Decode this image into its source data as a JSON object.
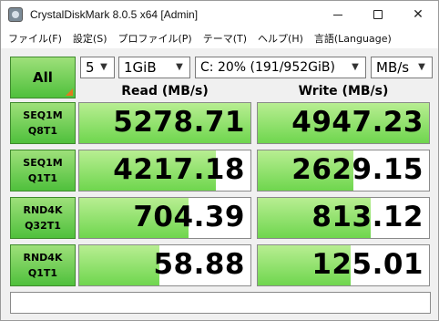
{
  "window": {
    "title": "CrystalDiskMark 8.0.5 x64 [Admin]"
  },
  "window_controls": {
    "minimize": "—",
    "maximize": "☐",
    "close": "✕"
  },
  "menu": [
    "ファイル(F)",
    "設定(S)",
    "プロファイル(P)",
    "テーマ(T)",
    "ヘルプ(H)",
    "言語(Language)"
  ],
  "toolbar": {
    "all_label": "All",
    "count": "5",
    "size": "1GiB",
    "drive": "C: 20% (191/952GiB)",
    "unit": "MB/s"
  },
  "headers": {
    "read": "Read (MB/s)",
    "write": "Write (MB/s)"
  },
  "tests": [
    {
      "line1": "SEQ1M",
      "line2": "Q8T1",
      "read": "5278.71",
      "write": "4947.23",
      "read_fill": 1.0,
      "write_fill": 1.0
    },
    {
      "line1": "SEQ1M",
      "line2": "Q1T1",
      "read": "4217.18",
      "write": "2629.15",
      "read_fill": 0.8,
      "write_fill": 0.56
    },
    {
      "line1": "RND4K",
      "line2": "Q32T1",
      "read": "704.39",
      "write": "813.12",
      "read_fill": 0.64,
      "write_fill": 0.66
    },
    {
      "line1": "RND4K",
      "line2": "Q1T1",
      "read": "58.88",
      "write": "125.01",
      "read_fill": 0.47,
      "write_fill": 0.54
    }
  ],
  "comment": ""
}
